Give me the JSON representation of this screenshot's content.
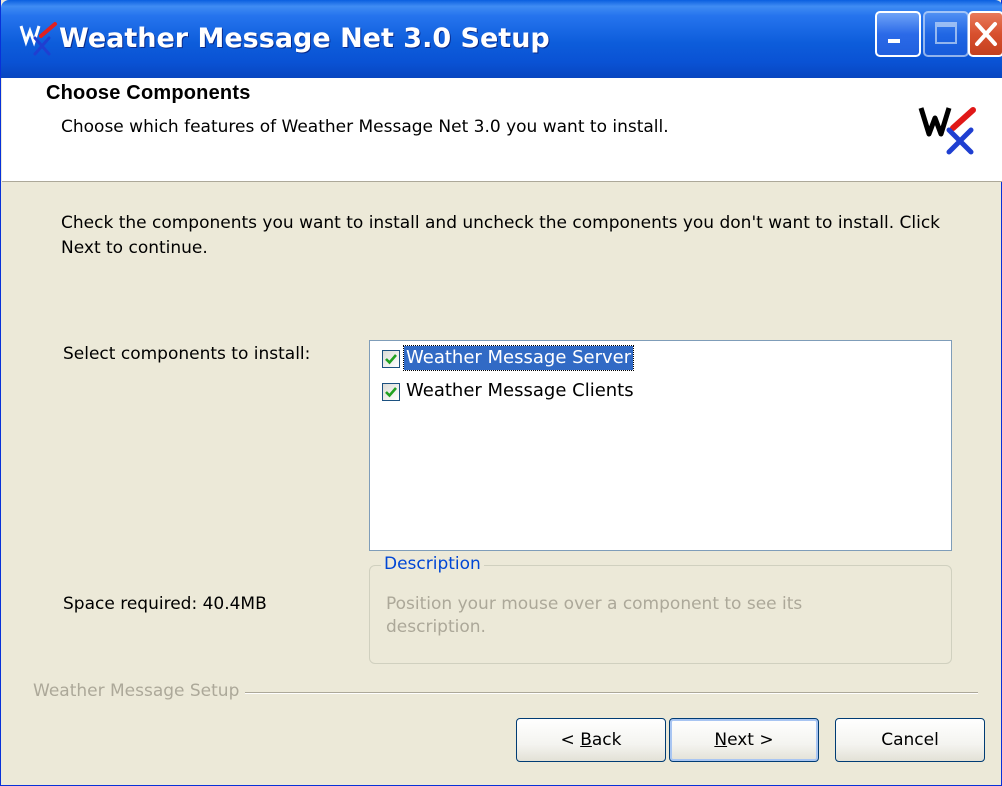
{
  "window": {
    "title": "Weather Message Net 3.0 Setup",
    "icon": "wx-app-icon"
  },
  "header": {
    "title": "Choose Components",
    "subtitle": "Choose which features of Weather Message Net 3.0 you want to install."
  },
  "body": {
    "intro": "Check the components you want to install and uncheck the components you don't want to install. Click Next to continue.",
    "select_label": "Select components to install:",
    "space_required": "Space required: 40.4MB"
  },
  "components": [
    {
      "label": "Weather Message Server",
      "checked": true,
      "selected": true
    },
    {
      "label": "Weather Message Clients",
      "checked": true,
      "selected": false
    }
  ],
  "description": {
    "legend": "Description",
    "text": "Position your mouse over a component to see its description."
  },
  "footer": {
    "brand": "Weather Message Setup",
    "back_prefix": "< ",
    "back_accel": "B",
    "back_rest": "ack",
    "next_accel": "N",
    "next_rest": "ext >",
    "cancel": "Cancel"
  },
  "colors": {
    "titlebar": "#0a52d4",
    "dialog": "#ece9d8",
    "selection": "#316ac5",
    "legend": "#0046d5",
    "disabled_text": "#aca899"
  }
}
